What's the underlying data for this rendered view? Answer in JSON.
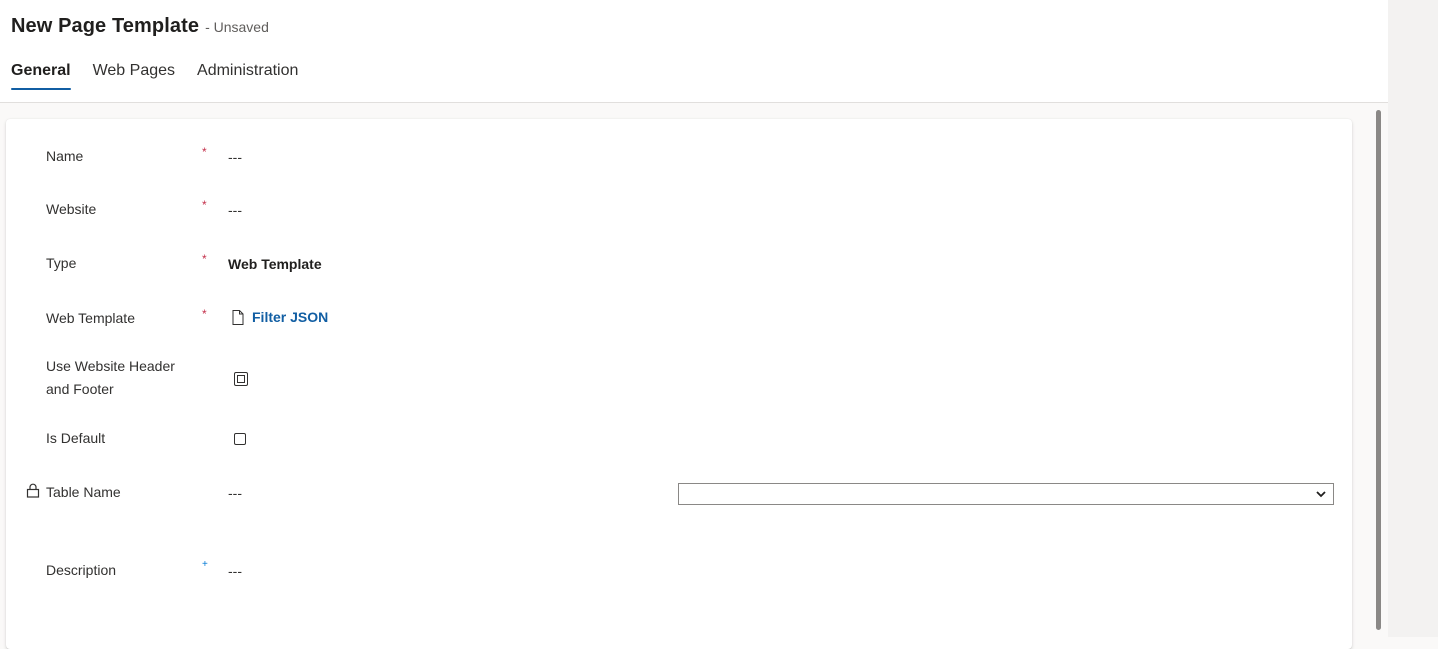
{
  "header": {
    "title": "New Page Template",
    "status": "- Unsaved"
  },
  "tabs": [
    {
      "label": "General",
      "active": true
    },
    {
      "label": "Web Pages",
      "active": false
    },
    {
      "label": "Administration",
      "active": false
    }
  ],
  "form": {
    "name": {
      "label": "Name",
      "required": "*",
      "value": "---"
    },
    "website": {
      "label": "Website",
      "required": "*",
      "value": "---"
    },
    "type": {
      "label": "Type",
      "required": "*",
      "value": "Web Template"
    },
    "web_template": {
      "label": "Web Template",
      "required": "*",
      "link": "Filter JSON",
      "icon": "document-icon"
    },
    "use_header_footer": {
      "label_line1": "Use Website Header",
      "label_line2": "and Footer",
      "checked": false
    },
    "is_default": {
      "label": "Is Default",
      "checked": false
    },
    "table_name": {
      "label": "Table Name",
      "value": "---",
      "locked": true,
      "select_value": ""
    },
    "description": {
      "label": "Description",
      "recommended": "+",
      "value": "---"
    }
  },
  "colors": {
    "accent": "#115ea3",
    "required": "#c4314b"
  }
}
